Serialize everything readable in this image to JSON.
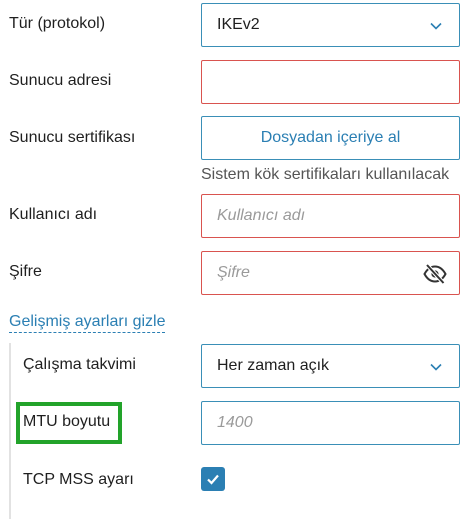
{
  "type_protocol": {
    "label": "Tür (protokol)",
    "value": "IKEv2"
  },
  "server_address": {
    "label": "Sunucu adresi",
    "value": ""
  },
  "server_certificate": {
    "label": "Sunucu sertifikası",
    "button_label": "Dosyadan içeriye al",
    "hint": "Sistem kök sertifikaları kullanılacak"
  },
  "username": {
    "label": "Kullanıcı adı",
    "placeholder": "Kullanıcı adı"
  },
  "password": {
    "label": "Şifre",
    "placeholder": "Şifre",
    "icon": "eye-slash-icon"
  },
  "advanced_toggle": {
    "label": "Gelişmiş ayarları gizle"
  },
  "schedule": {
    "label": "Çalışma takvimi",
    "value": "Her zaman açık"
  },
  "mtu": {
    "label": "MTU boyutu",
    "placeholder": "1400"
  },
  "tcp_mss": {
    "label": "TCP MSS ayarı",
    "checked": true
  },
  "colors": {
    "accent": "#2b7fb3",
    "invalid_border": "#d9534f",
    "highlight": "#22a32a"
  }
}
